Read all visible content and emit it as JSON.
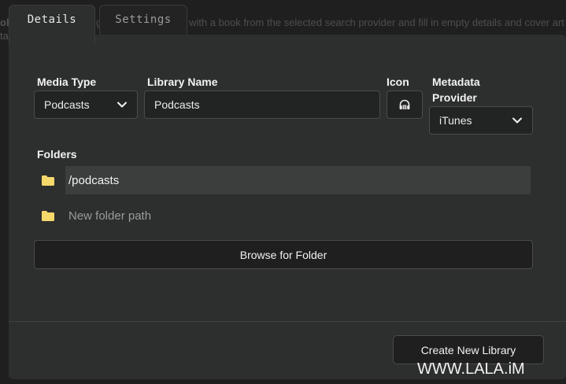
{
  "tabs": [
    {
      "label": "Details",
      "active": true
    },
    {
      "label": "Settings",
      "active": false
    }
  ],
  "background_text": {
    "line1_a": "g",
    "line1_b": "with a book from the selected search provider and fill in empty details and cover art",
    "line1_bold": "ok",
    "line2": "ta"
  },
  "form": {
    "media_type": {
      "label": "Media Type",
      "value": "Podcasts"
    },
    "library_name": {
      "label": "Library Name",
      "value": "Podcasts"
    },
    "icon": {
      "label": "Icon",
      "icon_name": "podcast-icon"
    },
    "metadata_provider": {
      "label": "Metadata Provider",
      "value": "iTunes"
    }
  },
  "folders": {
    "label": "Folders",
    "items": [
      "/podcasts"
    ],
    "new_placeholder": "New folder path"
  },
  "buttons": {
    "browse": "Browse for Folder",
    "create": "Create New Library"
  },
  "watermark": "WWW.LALA.iM",
  "colors": {
    "folder_icon": "#f7d96b",
    "card_bg": "#2d2e2e",
    "page_bg": "#1f1f1f"
  }
}
